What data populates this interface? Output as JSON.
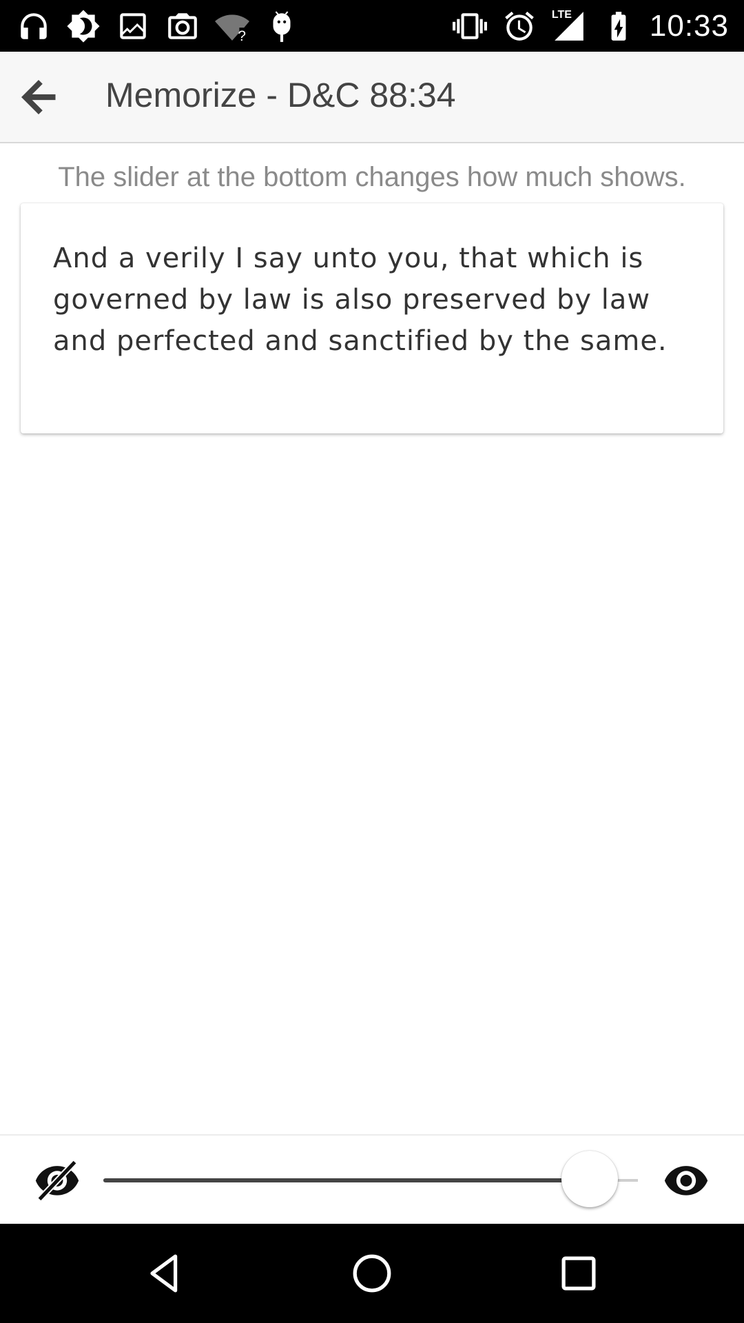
{
  "status_bar": {
    "time": "10:33",
    "network_label": "LTE",
    "left_icons": [
      "headphones-icon",
      "brightness-icon",
      "image-icon",
      "camera-icon",
      "wifi-unknown-icon",
      "android-debug-icon"
    ],
    "right_icons": [
      "vibrate-icon",
      "alarm-icon",
      "cell-signal-lte-icon",
      "battery-charging-icon"
    ]
  },
  "app_bar": {
    "title": "Memorize - D&C 88:34",
    "back_icon": "arrow-back-icon"
  },
  "hint": "The slider at the bottom changes how much shows.",
  "verse": {
    "text": "And a verily I say unto you, that which is governed by law is also preserved by law and perfected and sanctified by the same."
  },
  "slider": {
    "min_icon": "eye-off-icon",
    "max_icon": "eye-icon",
    "value_fraction": 0.91
  },
  "nav_bar": {
    "buttons": [
      "nav-back-icon",
      "nav-home-icon",
      "nav-recents-icon"
    ]
  },
  "colors": {
    "status_bar": "#000000",
    "app_bar": "#f7f7f7",
    "title_text": "#444444",
    "hint_text": "#8a8a8a",
    "verse_text": "#333333",
    "slider_fill": "#444444",
    "slider_track": "#cfcfcf"
  }
}
